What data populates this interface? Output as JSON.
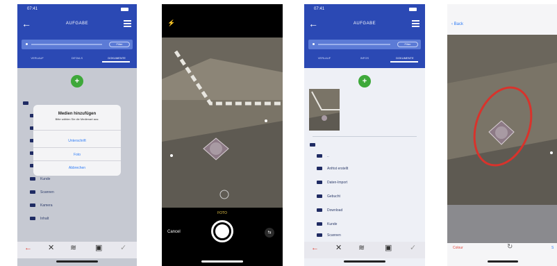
{
  "phone1": {
    "status_time": "07:41",
    "title": "AUFGABE",
    "search_filter": "Filter",
    "tabs": [
      "VERLAUF",
      "DETAILS",
      "DOKUMENTE"
    ],
    "dialog": {
      "title": "Medien hinzufügen",
      "subtitle": "Bitte wählen Sie die Medienart aus:",
      "options": [
        "Unterschrift",
        "Foto",
        "Abbrechen"
      ]
    },
    "folders": [
      "Kunde",
      "Scannen",
      "Kamera",
      "Inhalt"
    ],
    "toolbar_icons": [
      "back-arrow-icon",
      "close-icon",
      "signature-icon",
      "calendar-icon",
      "check-icon"
    ]
  },
  "phone2": {
    "mode_label": "FOTO",
    "cancel_label": "Cancel"
  },
  "phone3": {
    "status_time": "07:41",
    "title": "AUFGABE",
    "search_filter": "Filter",
    "tabs": [
      "VERLAUF",
      "INFOS",
      "DOKUMENTE"
    ],
    "folders": [
      "..",
      "Anfrist erstellt",
      "Daten-Import",
      "Gebucht",
      "Download",
      "Kunde",
      "Scannen"
    ]
  },
  "phone4": {
    "back_label": "Back",
    "colour_label": "Colour",
    "save_label": "S"
  },
  "colors": {
    "app_blue": "#2b49b4",
    "search_blue": "#5c7bd6",
    "add_green": "#3ea83a",
    "folder_navy": "#1f2b63",
    "cancel_red": "#e0443a",
    "ios_blue": "#2f7cf6",
    "annotation_red": "#d8332c"
  }
}
